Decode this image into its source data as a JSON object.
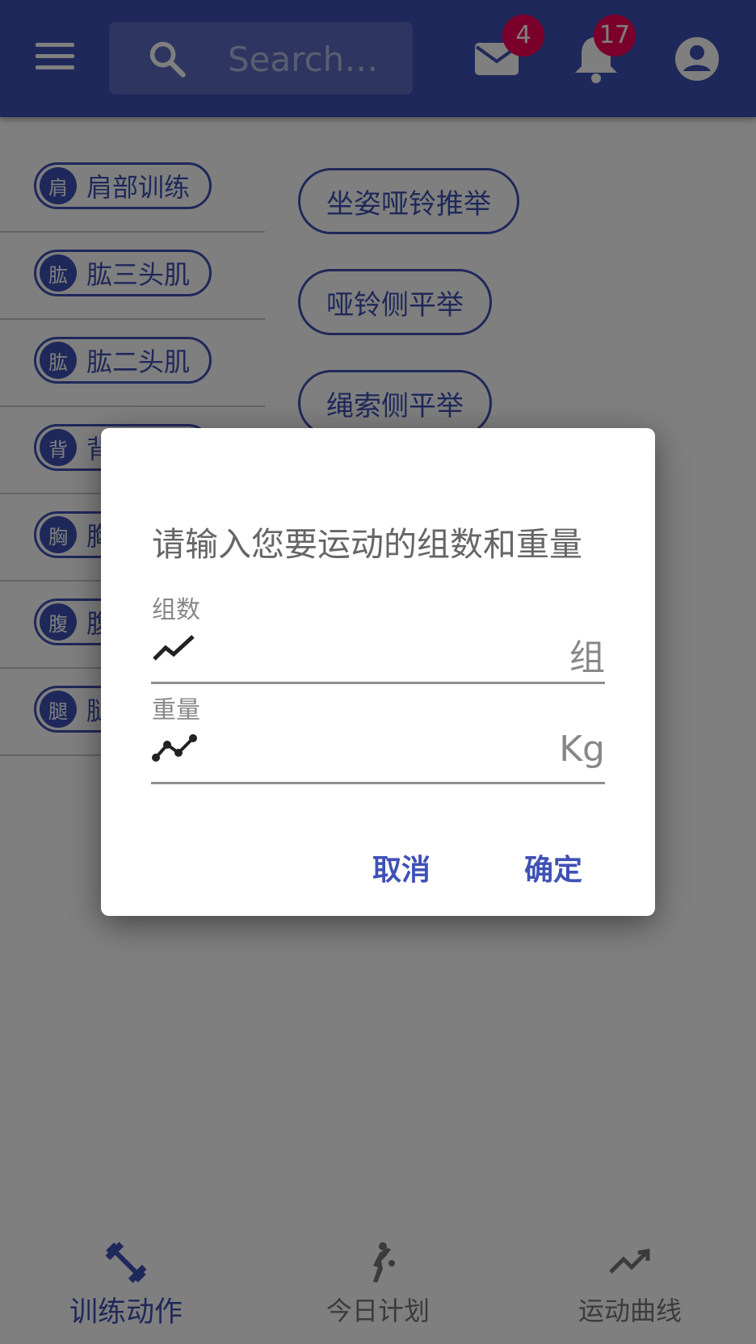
{
  "appbar": {
    "search_placeholder": "Search…",
    "mail_badge": "4",
    "notification_badge": "17"
  },
  "categories": [
    {
      "avatar": "肩",
      "label": "肩部训练"
    },
    {
      "avatar": "肱",
      "label": "肱三头肌"
    },
    {
      "avatar": "肱",
      "label": "肱二头肌"
    },
    {
      "avatar": "背",
      "label": "背"
    },
    {
      "avatar": "胸",
      "label": "胸"
    },
    {
      "avatar": "腹",
      "label": "腹"
    },
    {
      "avatar": "腿",
      "label": "腿"
    }
  ],
  "exercises": [
    "坐姿哑铃推举",
    "哑铃侧平举",
    "绳索侧平举"
  ],
  "bottom_nav": {
    "items": [
      {
        "label": "训练动作",
        "icon": "fitness-center-icon",
        "active": true
      },
      {
        "label": "今日计划",
        "icon": "sports-handball-icon",
        "active": false
      },
      {
        "label": "运动曲线",
        "icon": "trending-up-icon",
        "active": false
      }
    ]
  },
  "dialog": {
    "title": "请输入您要运动的组数和重量",
    "sets": {
      "label": "组数",
      "unit": "组",
      "value": ""
    },
    "weight": {
      "label": "重量",
      "unit": "Kg",
      "value": ""
    },
    "cancel_label": "取消",
    "confirm_label": "确定"
  },
  "colors": {
    "primary": "#3f51b5",
    "badge": "#f50057",
    "scrim": "rgba(0,0,0,0.5)"
  }
}
